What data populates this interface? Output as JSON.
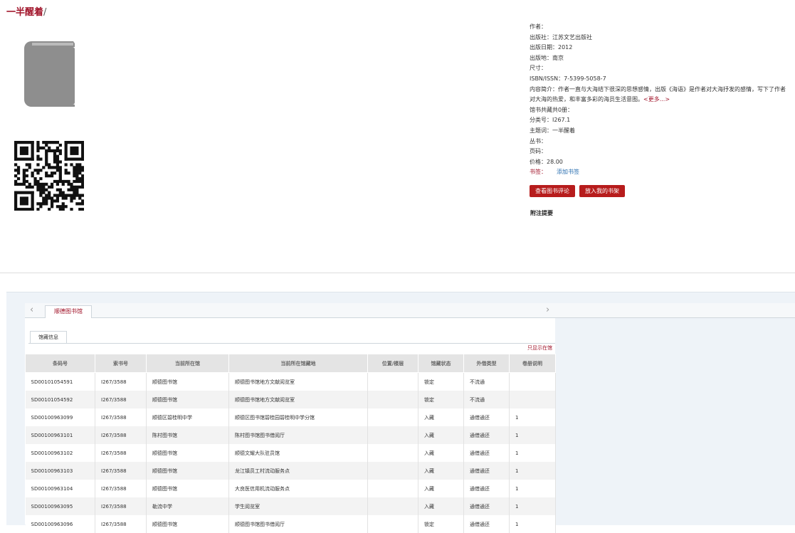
{
  "book": {
    "title": "一半醒着",
    "slash": "/",
    "cover_icon": "book-icon",
    "qr_icon": "qr-code-icon"
  },
  "info": {
    "author": "作者：",
    "publisher": "出版社：江苏文艺出版社",
    "pub_date": "出版日期：2012",
    "pub_place": "出版地：南京",
    "size": "尺寸：",
    "isbn": "ISBN/ISSN：7-5399-5058-7",
    "intro_line1": "内容简介：作者一直与大海结下很深的思想感情，出版《海语》是作者对大海抒发的感情，写下了作者",
    "intro_line2": "对大海的热爱，和丰富多彩的海员生活意图。",
    "more": "<更多...>",
    "holdings_total": "馆书共藏共0册：",
    "class_no": "分类号：I267.1",
    "subject": "主题词：一半醒着",
    "series": "丛书：",
    "pages": "页码：",
    "price": "价格：28.00",
    "tag_label": "书签：",
    "tag_add": "添加书签"
  },
  "buttons": {
    "view_review": "查看图书评论",
    "add_shelf": "放入我的书架"
  },
  "note_heading": "附注提要",
  "tabs": {
    "library": "顺德图书馆",
    "holdings": "馆藏信息",
    "prev_arrow": "‹",
    "next_arrow": "›"
  },
  "only_in_library": "只显示在馆",
  "table": {
    "headers": [
      "条码号",
      "索书号",
      "当前所在馆",
      "当前所在馆藏地",
      "位置/楼层",
      "馆藏状态",
      "外借类型",
      "卷册说明"
    ],
    "rows": [
      [
        "SD00101054591",
        "I267/3588",
        "顺德图书馆",
        "顺德图书馆地方文献阅览室",
        "",
        "锁定",
        "不流通",
        ""
      ],
      [
        "SD00101054592",
        "I267/3588",
        "顺德图书馆",
        "顺德图书馆地方文献阅览室",
        "",
        "锁定",
        "不流通",
        ""
      ],
      [
        "SD00100963099",
        "I267/3588",
        "顺德区碧桂明中学",
        "顺德区图书馆碧桂园碧桂明中学分馆",
        "",
        "入藏",
        "通借通还",
        "1"
      ],
      [
        "SD00100963101",
        "I267/3588",
        "陈村图书馆",
        "陈村图书馆图书借阅厅",
        "",
        "入藏",
        "通借通还",
        "1"
      ],
      [
        "SD00100963102",
        "I267/3588",
        "顺德图书馆",
        "顺德文耀大队驻员馆",
        "",
        "入藏",
        "通借通还",
        "1"
      ],
      [
        "SD00100963103",
        "I267/3588",
        "顺德图书馆",
        "龙江镇员工村流动服务点",
        "",
        "入藏",
        "通借通还",
        "1"
      ],
      [
        "SD00100963104",
        "I267/3588",
        "顺德图书馆",
        "大良医信用机流动服务点",
        "",
        "入藏",
        "通借通还",
        "1"
      ],
      [
        "SD00100963095",
        "I267/3588",
        "勒流中学",
        "学生阅览室",
        "",
        "入藏",
        "通借通还",
        "1"
      ],
      [
        "SD00100963096",
        "I267/3588",
        "顺德图书馆",
        "顺德图书馆图书借阅厅",
        "",
        "锁定",
        "通借通还",
        "1"
      ]
    ]
  }
}
